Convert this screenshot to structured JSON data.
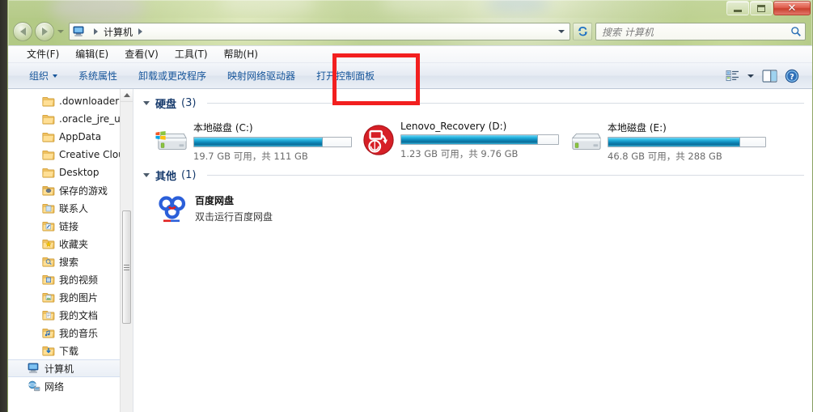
{
  "window": {
    "controls": {
      "minimize_label": "最小化",
      "maximize_label": "最大化",
      "close_label": "关闭"
    }
  },
  "address_bar": {
    "back_label": "后退",
    "forward_label": "前进",
    "history_label": "最近浏览的位置",
    "breadcrumb": [
      "计算机"
    ],
    "refresh_label": "刷新"
  },
  "search": {
    "placeholder": "搜索 计算机"
  },
  "menubar": {
    "items": [
      {
        "label": "文件(F)"
      },
      {
        "label": "编辑(E)"
      },
      {
        "label": "查看(V)"
      },
      {
        "label": "工具(T)"
      },
      {
        "label": "帮助(H)"
      }
    ]
  },
  "toolbar": {
    "items": [
      {
        "label": "组织",
        "has_caret": true
      },
      {
        "label": "系统属性",
        "has_caret": false
      },
      {
        "label": "卸载或更改程序",
        "has_caret": false
      },
      {
        "label": "映射网络驱动器",
        "has_caret": false
      },
      {
        "label": "打开控制面板",
        "has_caret": false,
        "highlighted": true
      }
    ],
    "right_icons": [
      {
        "name": "view-options-icon"
      },
      {
        "name": "chevron-down-icon"
      },
      {
        "name": "preview-pane-icon"
      },
      {
        "name": "help-icon"
      }
    ]
  },
  "highlight": {
    "color": "#f21f1f",
    "target_label": "打开控制面板"
  },
  "sidebar": {
    "items": [
      {
        "label": ".downloader",
        "icon": "folder-icon",
        "selected": false
      },
      {
        "label": ".oracle_jre_usä",
        "icon": "folder-icon",
        "selected": false
      },
      {
        "label": "AppData",
        "icon": "folder-icon",
        "selected": false
      },
      {
        "label": "Creative Clou",
        "icon": "folder-icon",
        "selected": false
      },
      {
        "label": "Desktop",
        "icon": "folder-icon",
        "selected": false
      },
      {
        "label": "保存的游戏",
        "icon": "saved-games-folder-icon",
        "selected": false
      },
      {
        "label": "联系人",
        "icon": "contacts-folder-icon",
        "selected": false
      },
      {
        "label": "链接",
        "icon": "links-folder-icon",
        "selected": false
      },
      {
        "label": "收藏夹",
        "icon": "favorites-folder-icon",
        "selected": false
      },
      {
        "label": "搜索",
        "icon": "searches-folder-icon",
        "selected": false
      },
      {
        "label": "我的视频",
        "icon": "videos-folder-icon",
        "selected": false
      },
      {
        "label": "我的图片",
        "icon": "pictures-folder-icon",
        "selected": false
      },
      {
        "label": "我的文档",
        "icon": "documents-folder-icon",
        "selected": false
      },
      {
        "label": "我的音乐",
        "icon": "music-folder-icon",
        "selected": false
      },
      {
        "label": "下载",
        "icon": "downloads-folder-icon",
        "selected": false
      },
      {
        "label": "计算机",
        "icon": "computer-icon",
        "selected": true,
        "root": true
      },
      {
        "label": "网络",
        "icon": "network-icon",
        "selected": false,
        "root": true
      }
    ]
  },
  "main": {
    "groups": [
      {
        "title": "硬盘",
        "count": "(3)",
        "type": "drives",
        "items": [
          {
            "name": "本地磁盘 (C:)",
            "icon": "system-drive-icon",
            "free": "19.7 GB",
            "total": "111 GB",
            "sub": "19.7 GB 可用，共 111 GB",
            "used_percent": 82
          },
          {
            "name": "Lenovo_Recovery (D:)",
            "icon": "recovery-drive-icon",
            "free": "1.23 GB",
            "total": "9.76 GB",
            "sub": "1.23 GB 可用，共 9.76 GB",
            "used_percent": 87
          },
          {
            "name": "本地磁盘 (E:)",
            "icon": "local-drive-icon",
            "free": "46.8 GB",
            "total": "288 GB",
            "sub": "46.8 GB 可用，共 288 GB",
            "used_percent": 84
          }
        ]
      },
      {
        "title": "其他",
        "count": "(1)",
        "type": "others",
        "items": [
          {
            "name": "百度网盘",
            "icon": "baidu-netdisk-icon",
            "sub": "双击运行百度网盘"
          }
        ]
      }
    ]
  }
}
